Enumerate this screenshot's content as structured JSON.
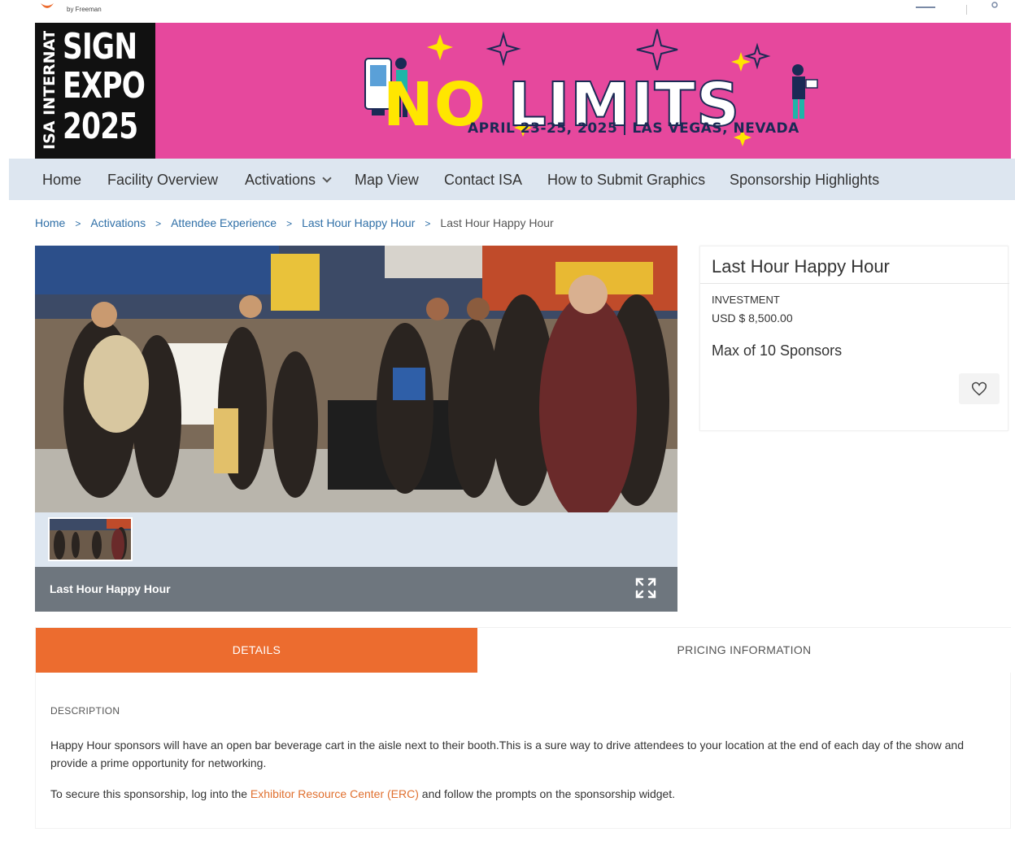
{
  "topbar": {
    "by_freeman": "by Freeman"
  },
  "banner": {
    "logo_side": "ISA INTERNATIONAL",
    "logo_line1": "SIGN",
    "logo_line2": "EXPO",
    "logo_line3": "2025",
    "tagline_no": "NO",
    "tagline_limits": "LIMITS",
    "dates": "APRIL 23-25, 2025",
    "location": "LAS VEGAS, NEVADA"
  },
  "nav": {
    "items": [
      {
        "label": "Home"
      },
      {
        "label": "Facility Overview"
      },
      {
        "label": "Activations"
      },
      {
        "label": "Map View"
      },
      {
        "label": "Contact ISA"
      },
      {
        "label": "How to Submit Graphics"
      },
      {
        "label": "Sponsorship Highlights"
      }
    ]
  },
  "breadcrumb": {
    "items": [
      "Home",
      "Activations",
      "Attendee Experience",
      "Last Hour Happy Hour"
    ],
    "current": "Last Hour Happy Hour"
  },
  "gallery": {
    "caption": "Last Hour Happy Hour"
  },
  "card": {
    "title": "Last Hour Happy Hour",
    "investment_label": "INVESTMENT",
    "investment_value": "USD $ 8,500.00",
    "max_sponsors": "Max of 10 Sponsors"
  },
  "tabs": {
    "details": "DETAILS",
    "pricing": "PRICING INFORMATION"
  },
  "details": {
    "description_label": "DESCRIPTION",
    "paragraph1": "Happy Hour sponsors will have an open bar beverage cart in the aisle next to their booth.This is a sure way to drive attendees to your location at the end of each day of the show and provide a prime opportunity for networking.",
    "paragraph2_prefix": "To secure this sponsorship, log into the ",
    "paragraph2_link": "Exhibitor Resource Center (ERC)",
    "paragraph2_suffix": " and follow the prompts on the sponsorship widget."
  },
  "colors": {
    "accent": "#ec6c2f",
    "nav_bg": "#dde6f0",
    "banner_pink": "#e6489d",
    "link_blue": "#2f6fa7"
  }
}
